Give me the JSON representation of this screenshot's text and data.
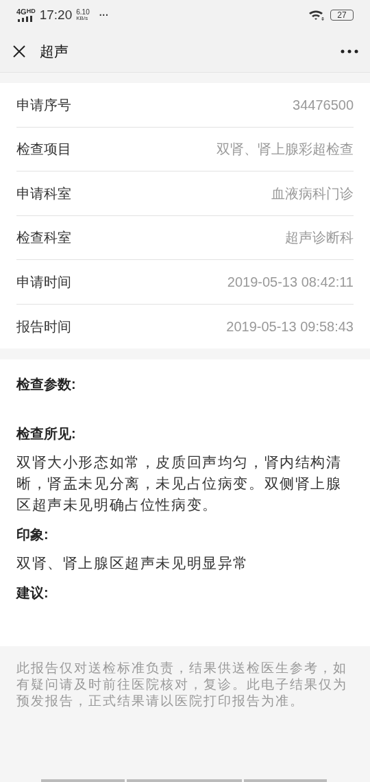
{
  "status_bar": {
    "network": "4G",
    "network_badge": "HD",
    "time": "17:20",
    "speed": "6.10",
    "speed_unit": "KB/s",
    "more": "···",
    "battery": "27"
  },
  "title_bar": {
    "title": "超声"
  },
  "info_rows": [
    {
      "label": "申请序号",
      "value": "34476500"
    },
    {
      "label": "检查项目",
      "value": "双肾、肾上腺彩超检查"
    },
    {
      "label": "申请科室",
      "value": "血液病科门诊"
    },
    {
      "label": "检查科室",
      "value": "超声诊断科"
    },
    {
      "label": "申请时间",
      "value": "2019-05-13 08:42:11"
    },
    {
      "label": "报告时间",
      "value": "2019-05-13 09:58:43"
    }
  ],
  "sections": [
    {
      "heading": "检查参数:"
    },
    {
      "heading": "检查所见:",
      "body": "双肾大小形态如常，皮质回声均匀，肾内结构清晰，肾盂未见分离，未见占位病变。双侧肾上腺区超声未见明确占位性病变。"
    },
    {
      "heading": "印象:",
      "body": "双肾、肾上腺区超声未见明显异常"
    },
    {
      "heading": "建议:"
    }
  ],
  "footer_note": "此报告仅对送检标准负责，结果供送检医生参考，如有疑问请及时前往医院核对，复诊。此电子结果仅为预发报告，正式结果请以医院打印报告为准。"
}
